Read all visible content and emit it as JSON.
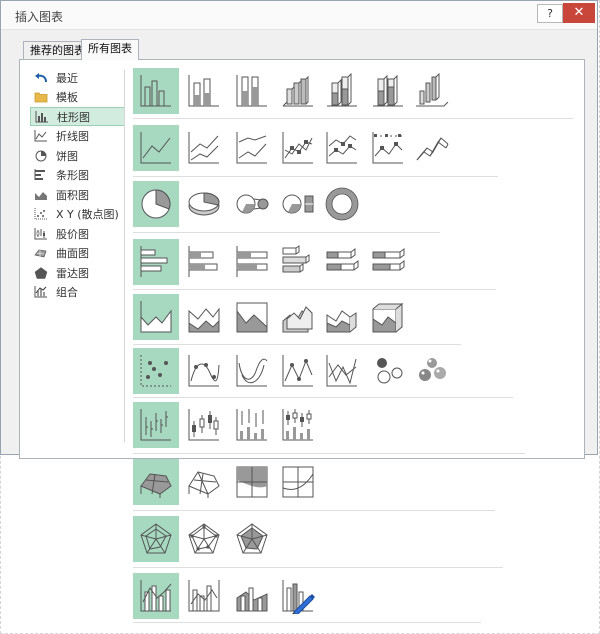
{
  "dialog": {
    "title": "插入图表",
    "help_label": "?",
    "close_label": "✕"
  },
  "tabs": [
    {
      "label": "推荐的图表",
      "active": false
    },
    {
      "label": "所有图表",
      "active": true
    }
  ],
  "sidebar": {
    "items": [
      {
        "label": "最近",
        "icon": "undo-arrow-icon"
      },
      {
        "label": "模板",
        "icon": "folder-icon"
      },
      {
        "label": "柱形图",
        "icon": "column-chart-icon",
        "selected": true
      },
      {
        "label": "折线图",
        "icon": "line-chart-icon"
      },
      {
        "label": "饼图",
        "icon": "pie-chart-icon"
      },
      {
        "label": "条形图",
        "icon": "bar-chart-icon"
      },
      {
        "label": "面积图",
        "icon": "area-chart-icon"
      },
      {
        "label": "X Y (散点图)",
        "icon": "scatter-chart-icon"
      },
      {
        "label": "股价图",
        "icon": "stock-chart-icon"
      },
      {
        "label": "曲面图",
        "icon": "surface-chart-icon"
      },
      {
        "label": "雷达图",
        "icon": "radar-chart-icon"
      },
      {
        "label": "组合",
        "icon": "combo-chart-icon"
      }
    ]
  },
  "chart_rows": [
    {
      "category": "column",
      "thumbs": [
        "clustered-column",
        "stacked-column",
        "100-stacked-column",
        "3d-clustered-column",
        "3d-stacked-column",
        "3d-100-stacked-column",
        "3d-column"
      ]
    },
    {
      "category": "line",
      "thumbs": [
        "line",
        "stacked-line",
        "100-stacked-line",
        "line-with-markers",
        "stacked-line-markers",
        "100-stacked-line-markers",
        "3d-line"
      ]
    },
    {
      "category": "pie",
      "thumbs": [
        "pie",
        "3d-pie",
        "pie-of-pie",
        "bar-of-pie",
        "doughnut"
      ]
    },
    {
      "category": "bar",
      "thumbs": [
        "clustered-bar",
        "stacked-bar",
        "100-stacked-bar",
        "3d-clustered-bar",
        "3d-stacked-bar",
        "3d-100-stacked-bar"
      ]
    },
    {
      "category": "area",
      "thumbs": [
        "area",
        "stacked-area",
        "100-stacked-area",
        "3d-area",
        "3d-stacked-area",
        "3d-100-stacked-area"
      ]
    },
    {
      "category": "scatter",
      "thumbs": [
        "scatter",
        "scatter-smooth-markers",
        "scatter-smooth-lines",
        "scatter-straight-markers",
        "scatter-straight-lines",
        "bubble",
        "3d-bubble"
      ]
    },
    {
      "category": "stock",
      "thumbs": [
        "high-low-close",
        "open-high-low-close",
        "volume-high-low-close",
        "volume-open-high-low-close"
      ]
    },
    {
      "category": "surface",
      "thumbs": [
        "3d-surface",
        "wireframe-3d-surface",
        "contour",
        "wireframe-contour"
      ]
    },
    {
      "category": "radar",
      "thumbs": [
        "radar",
        "radar-with-markers",
        "filled-radar"
      ]
    },
    {
      "category": "combo",
      "thumbs": [
        "clustered-column-line",
        "clustered-column-line-secondary",
        "stacked-area-clustered-column",
        "custom-combination"
      ]
    }
  ],
  "colors": {
    "selected_fill": "#a6d9bf",
    "sidebar_selected": "#d2ecdf",
    "close_red": "#c9473a",
    "icon_gray": "#7f7f7f"
  }
}
